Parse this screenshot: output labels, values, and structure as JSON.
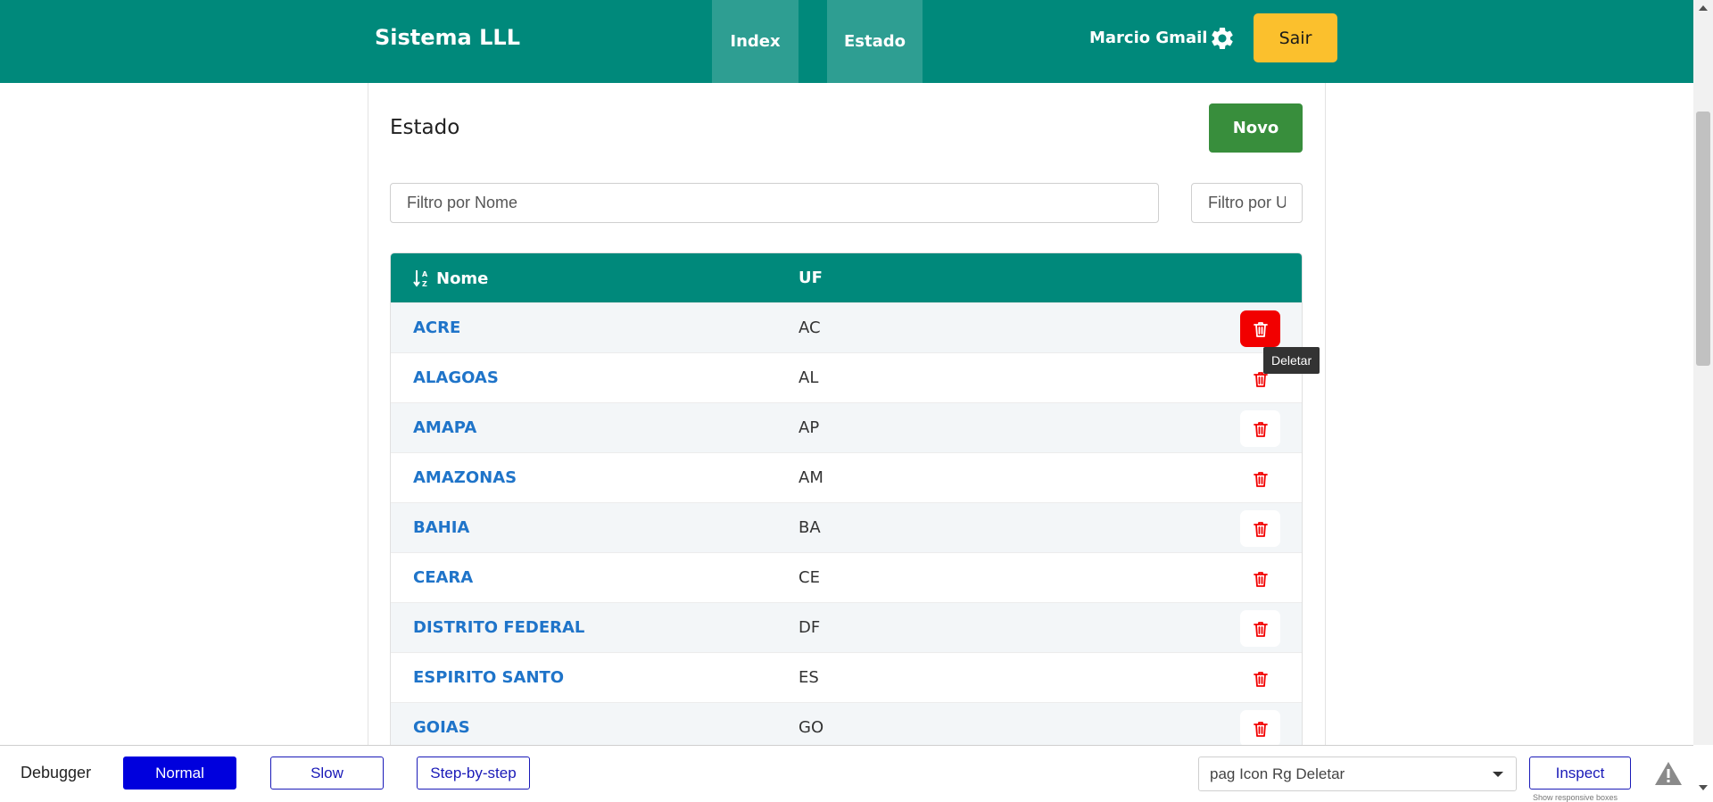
{
  "app": {
    "brand": "Sistema LLL"
  },
  "nav": {
    "index_label": "Index",
    "estado_label": "Estado"
  },
  "user": {
    "name": "Marcio Gmail",
    "logout_label": "Sair"
  },
  "page": {
    "title": "Estado",
    "new_button_label": "Novo"
  },
  "filters": {
    "nome_placeholder": "Filtro por Nome",
    "uf_placeholder": "Filtro por UF"
  },
  "table": {
    "columns": {
      "nome": "Nome",
      "uf": "UF"
    },
    "rows": [
      {
        "nome": "ACRE",
        "uf": "AC"
      },
      {
        "nome": "ALAGOAS",
        "uf": "AL"
      },
      {
        "nome": "AMAPA",
        "uf": "AP"
      },
      {
        "nome": "AMAZONAS",
        "uf": "AM"
      },
      {
        "nome": "BAHIA",
        "uf": "BA"
      },
      {
        "nome": "CEARA",
        "uf": "CE"
      },
      {
        "nome": "DISTRITO FEDERAL",
        "uf": "DF"
      },
      {
        "nome": "ESPIRITO SANTO",
        "uf": "ES"
      },
      {
        "nome": "GOIAS",
        "uf": "GO"
      }
    ],
    "tooltip": "Deletar"
  },
  "debugger": {
    "label": "Debugger",
    "normal_label": "Normal",
    "slow_label": "Slow",
    "step_label": "Step-by-step",
    "selected_target": "pag Icon Rg Deletar",
    "inspect_label": "Inspect",
    "responsive_label": "Show responsive boxes"
  },
  "colors": {
    "primary": "#00897b",
    "accent_yellow": "#fbc02d",
    "success_green": "#388e3c",
    "link_blue": "#1f74c9",
    "danger_red": "#f20000",
    "debugger_blue": "#0000dd"
  },
  "icons": {
    "settings": "gear-icon",
    "sort": "sort-alpha-icon",
    "delete": "trash-icon",
    "warning": "warning-icon"
  }
}
